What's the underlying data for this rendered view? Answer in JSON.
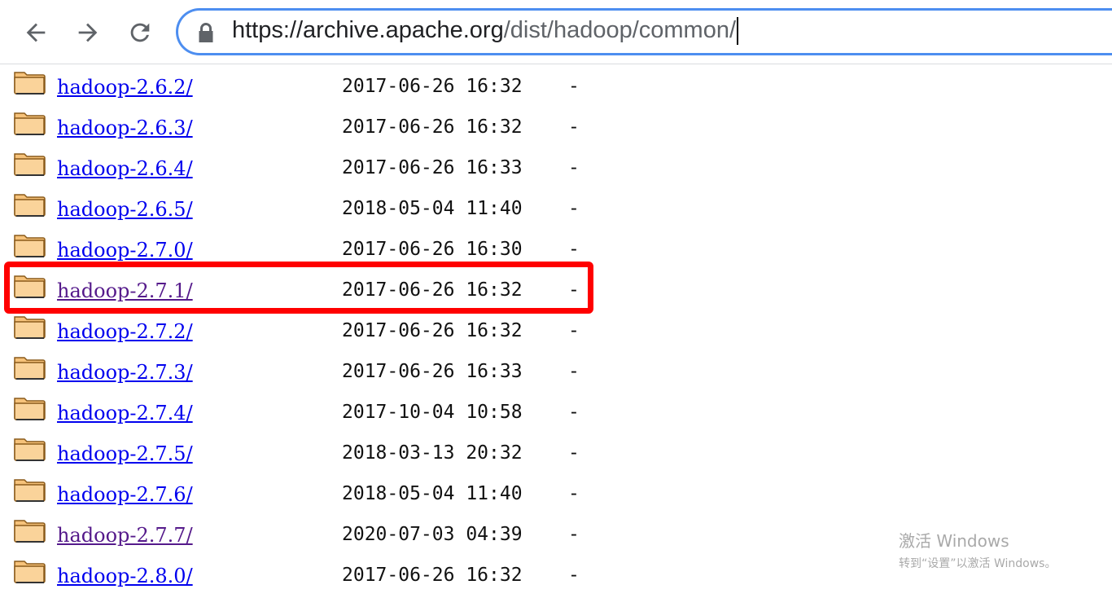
{
  "browser": {
    "url_host": "https://archive.apache.org",
    "url_path": "/dist/hadoop/common/",
    "back_icon": "arrow-left-icon",
    "forward_icon": "arrow-right-icon",
    "reload_icon": "reload-icon",
    "lock_icon": "lock-icon",
    "accent_color": "#4d8ef0"
  },
  "listing": {
    "rows": [
      {
        "name": "hadoop-2.6.2/",
        "date": "2017-06-26 16:32",
        "size": "-",
        "visited": false
      },
      {
        "name": "hadoop-2.6.3/",
        "date": "2017-06-26 16:32",
        "size": "-",
        "visited": false
      },
      {
        "name": "hadoop-2.6.4/",
        "date": "2017-06-26 16:33",
        "size": "-",
        "visited": false
      },
      {
        "name": "hadoop-2.6.5/",
        "date": "2018-05-04 11:40",
        "size": "-",
        "visited": false
      },
      {
        "name": "hadoop-2.7.0/",
        "date": "2017-06-26 16:30",
        "size": "-",
        "visited": false
      },
      {
        "name": "hadoop-2.7.1/",
        "date": "2017-06-26 16:32",
        "size": "-",
        "visited": true
      },
      {
        "name": "hadoop-2.7.2/",
        "date": "2017-06-26 16:32",
        "size": "-",
        "visited": false
      },
      {
        "name": "hadoop-2.7.3/",
        "date": "2017-06-26 16:33",
        "size": "-",
        "visited": false
      },
      {
        "name": "hadoop-2.7.4/",
        "date": "2017-10-04 10:58",
        "size": "-",
        "visited": false
      },
      {
        "name": "hadoop-2.7.5/",
        "date": "2018-03-13 20:32",
        "size": "-",
        "visited": false
      },
      {
        "name": "hadoop-2.7.6/",
        "date": "2018-05-04 11:40",
        "size": "-",
        "visited": false
      },
      {
        "name": "hadoop-2.7.7/",
        "date": "2020-07-03 04:39",
        "size": "-",
        "visited": true
      },
      {
        "name": "hadoop-2.8.0/",
        "date": "2017-06-26 16:32",
        "size": "-",
        "visited": false
      }
    ],
    "folder_icon": "folder-icon",
    "highlighted_row": "hadoop-2.7.1/",
    "highlight_color": "#ff0000"
  },
  "watermark": {
    "title": "激活 Windows",
    "subtitle": "转到“设置”以激活 Windows。"
  }
}
